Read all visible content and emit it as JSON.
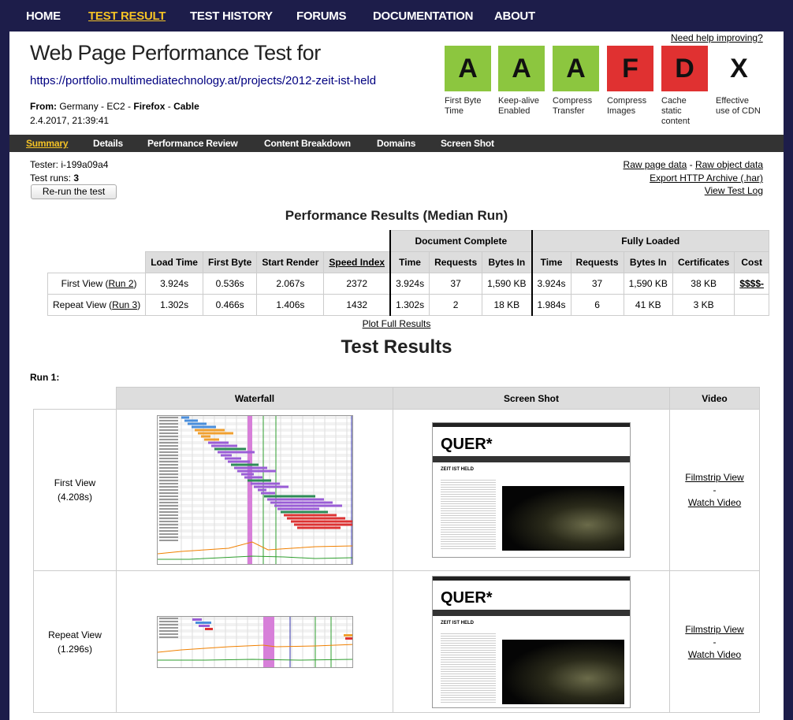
{
  "nav": {
    "home": "HOME",
    "test_result": "TEST RESULT",
    "test_history": "TEST HISTORY",
    "forums": "FORUMS",
    "documentation": "DOCUMENTATION",
    "about": "ABOUT"
  },
  "help_link": "Need help improving?",
  "header": {
    "title": "Web Page Performance Test for",
    "url": "https://portfolio.multimediatechnology.at/projects/2012-zeit-ist-held",
    "from_label": "From:",
    "location": "Germany - EC2",
    "sep1": " - ",
    "browser": "Firefox",
    "sep2": " - ",
    "connection": "Cable",
    "datetime": "2.4.2017, 21:39:41"
  },
  "grades": [
    {
      "grade": "A",
      "l1": "First Byte",
      "l2": "Time",
      "l3": "",
      "color": "#8cc63f"
    },
    {
      "grade": "A",
      "l1": "Keep-alive",
      "l2": "Enabled",
      "l3": "",
      "color": "#8cc63f"
    },
    {
      "grade": "A",
      "l1": "Compress",
      "l2": "Transfer",
      "l3": "",
      "color": "#8cc63f"
    },
    {
      "grade": "F",
      "l1": "Compress",
      "l2": "Images",
      "l3": "",
      "color": "#e03131"
    },
    {
      "grade": "D",
      "l1": "Cache",
      "l2": "static",
      "l3": "content",
      "color": "#e03131"
    },
    {
      "grade": "X",
      "l1": "Effective",
      "l2": "use of CDN",
      "l3": "",
      "color": "#ffffff"
    }
  ],
  "subnav": {
    "summary": "Summary",
    "details": "Details",
    "performance_review": "Performance Review",
    "content_breakdown": "Content Breakdown",
    "domains": "Domains",
    "screen_shot": "Screen Shot"
  },
  "tester": {
    "label": "Tester:",
    "value": "i-199a09a4",
    "runs_label": "Test runs:",
    "runs_value": "3",
    "rerun": "Re-run the test"
  },
  "links": {
    "raw_page": "Raw page data",
    "dash": " - ",
    "raw_object": "Raw object data",
    "export_har": "Export HTTP Archive (.har)",
    "view_log": "View Test Log"
  },
  "perf": {
    "title": "Performance Results (Median Run)",
    "group_doc": "Document Complete",
    "group_full": "Fully Loaded",
    "headers": [
      "Load Time",
      "First Byte",
      "Start Render",
      "Speed Index",
      "Time",
      "Requests",
      "Bytes In",
      "Time",
      "Requests",
      "Bytes In",
      "Certificates",
      "Cost"
    ],
    "rows": [
      {
        "label": "First View (",
        "run": "Run 2",
        "close": ")",
        "cells": [
          "3.924s",
          "0.536s",
          "2.067s",
          "2372",
          "3.924s",
          "37",
          "1,590 KB",
          "3.924s",
          "37",
          "1,590 KB",
          "38 KB",
          "$$$$-"
        ]
      },
      {
        "label": "Repeat View (",
        "run": "Run 3",
        "close": ")",
        "cells": [
          "1.302s",
          "0.466s",
          "1.406s",
          "1432",
          "1.302s",
          "2",
          "18 KB",
          "1.984s",
          "6",
          "41 KB",
          "3 KB",
          ""
        ]
      }
    ],
    "plot_link": "Plot Full Results"
  },
  "results": {
    "title": "Test Results",
    "run_label": "Run 1:",
    "col_waterfall": "Waterfall",
    "col_screenshot": "Screen Shot",
    "col_video": "Video",
    "rows": [
      {
        "label": "First View",
        "time": "(4.208s)",
        "filmstrip": "Filmstrip View",
        "dash": "-",
        "video": "Watch Video"
      },
      {
        "label": "Repeat View",
        "time": "(1.296s)",
        "filmstrip": "Filmstrip View",
        "dash": "-",
        "video": "Watch Video"
      }
    ],
    "thumb": {
      "logo": "QUER*",
      "heading": "ZEIT IST HELD"
    }
  }
}
